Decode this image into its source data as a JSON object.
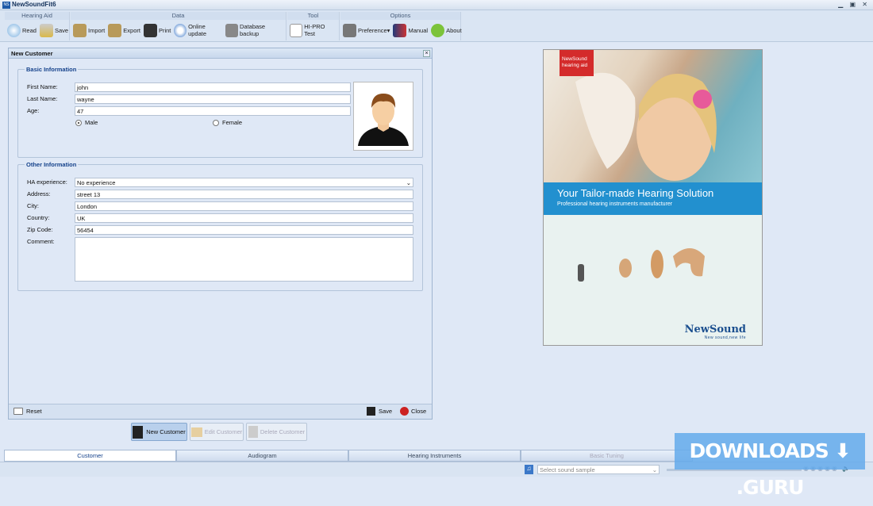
{
  "app": {
    "title": "NewSoundFit6",
    "logo": "NS"
  },
  "toolbar": {
    "groups": [
      {
        "title": "Hearing Aid",
        "items": [
          {
            "label": "Read",
            "icon": "read-icon"
          },
          {
            "label": "Save",
            "icon": "save-icon"
          }
        ]
      },
      {
        "title": "Data",
        "items": [
          {
            "label": "Import",
            "icon": "import-icon"
          },
          {
            "label": "Export",
            "icon": "export-icon"
          },
          {
            "label": "Print",
            "icon": "printer-icon"
          },
          {
            "label": "Online update",
            "icon": "update-icon"
          },
          {
            "label": "Database backup",
            "icon": "database-icon"
          }
        ]
      },
      {
        "title": "Tool",
        "items": [
          {
            "label": "HI-PRO Test",
            "icon": "hipro-icon"
          }
        ]
      },
      {
        "title": "Options",
        "items": [
          {
            "label": "Preference▾",
            "icon": "preference-icon"
          },
          {
            "label": "Manual",
            "icon": "manual-icon"
          },
          {
            "label": "About",
            "icon": "about-icon"
          }
        ]
      }
    ]
  },
  "panel": {
    "title": "New Customer",
    "close": "×",
    "basic": {
      "legend": "Basic Information",
      "first_name_label": "First Name:",
      "first_name": "john",
      "last_name_label": "Last Name:",
      "last_name": "wayne",
      "age_label": "Age:",
      "age": "47",
      "male": "Male",
      "female": "Female",
      "gender": "Male"
    },
    "other": {
      "legend": "Other Information",
      "ha_label": "HA experience:",
      "ha_value": "No experience",
      "address_label": "Address:",
      "address": "street 13",
      "city_label": "City:",
      "city": "London",
      "country_label": "Country:",
      "country": "UK",
      "zip_label": "Zip Code:",
      "zip": "56454",
      "comment_label": "Comment:",
      "comment": ""
    },
    "footer": {
      "reset": "Reset",
      "save": "Save",
      "close": "Close"
    }
  },
  "actions": {
    "new": "New Customer",
    "edit": "Edit Customer",
    "delete": "Delete Customer"
  },
  "tabs": [
    "Customer",
    "Audiogram",
    "Hearing Instruments",
    "Basic Tuning"
  ],
  "status": {
    "sound_placeholder": "Select sound sample"
  },
  "ad": {
    "badge1": "NewSound",
    "badge2": "hearing aid",
    "headline": "Your Tailor-made Hearing Solution",
    "sub": "Professional hearing instruments manufacturer",
    "brand": "NewSound",
    "slogan": "New sound,new life"
  },
  "watermark": "DOWNLOADS ⬇ .GURU"
}
